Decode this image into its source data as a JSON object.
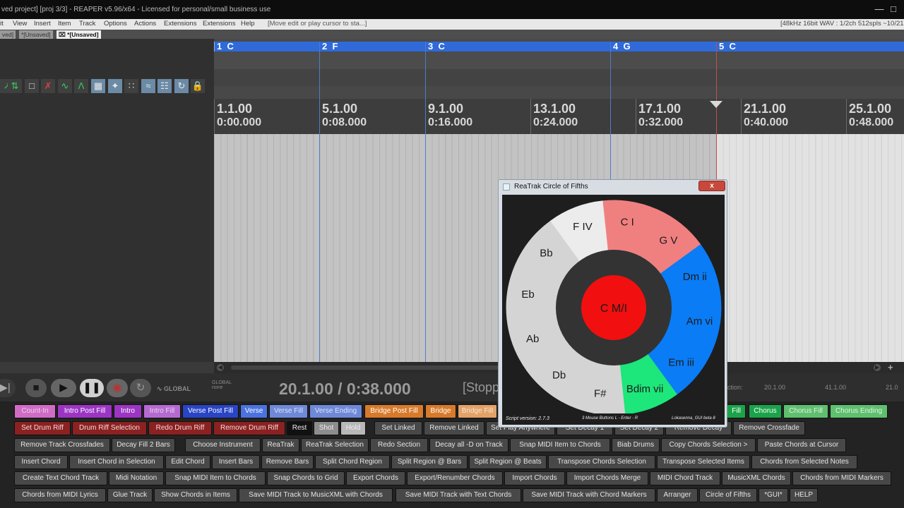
{
  "window": {
    "title": "ved project] [proj 3/3] - REAPER v5.96/x64 - Licensed for personal/small business use"
  },
  "menu": {
    "items": [
      "it",
      "View",
      "Insert",
      "Item",
      "Track",
      "Options",
      "Actions",
      "Extensions",
      "Extensions",
      "Help"
    ],
    "hint": "[Move edit or play cursor to sta...]",
    "status": "[48kHz 16bit WAV : 1/2ch 512spls ~10/21m"
  },
  "tabs": [
    "ved]",
    "*[Unsaved]",
    "*[Unsaved]"
  ],
  "regions": [
    {
      "num": "1",
      "chord": "C"
    },
    {
      "num": "2",
      "chord": "F"
    },
    {
      "num": "3",
      "chord": "C"
    },
    {
      "num": "4",
      "chord": "G"
    },
    {
      "num": "5",
      "chord": "C"
    }
  ],
  "ruler": [
    {
      "bar": "1.1.00",
      "time": "0:00.000"
    },
    {
      "bar": "5.1.00",
      "time": "0:08.000"
    },
    {
      "bar": "9.1.00",
      "time": "0:16.000"
    },
    {
      "bar": "13.1.00",
      "time": "0:24.000"
    },
    {
      "bar": "17.1.00",
      "time": "0:32.000"
    },
    {
      "bar": "21.1.00",
      "time": "0:40.000"
    },
    {
      "bar": "25.1.00",
      "time": "0:48.000"
    }
  ],
  "transport": {
    "global_label": "GLOBAL",
    "global_sub": "none",
    "position": "20.1.00 / 0:38.000",
    "state": "[Stopp",
    "selection_label": "ction:",
    "sel_values": [
      "20.1.00",
      "41.1.00",
      "21.0"
    ]
  },
  "dialog": {
    "title": "ReaTrak Circle of Fifths",
    "close": "x",
    "center": "C M/I",
    "segments": [
      {
        "label": "C I",
        "color": "#f08080"
      },
      {
        "label": "G V",
        "color": "#f08080"
      },
      {
        "label": "Dm ii",
        "color": "#0a7cf5"
      },
      {
        "label": "Am vi",
        "color": "#0a7cf5"
      },
      {
        "label": "Em iii",
        "color": "#0a7cf5"
      },
      {
        "label": "Bdim vii",
        "color": "#1de67a"
      },
      {
        "label": "F#",
        "color": "#d4d4d4"
      },
      {
        "label": "Db",
        "color": "#d4d4d4"
      },
      {
        "label": "Ab",
        "color": "#d4d4d4"
      },
      {
        "label": "Eb",
        "color": "#d4d4d4"
      },
      {
        "label": "Bb",
        "color": "#d4d4d4"
      },
      {
        "label": "F IV",
        "color": "#ececec"
      }
    ],
    "footer_left": "Script version: 2.7.3",
    "footer_mid": "3 Mouse Buttons L - Enter - R",
    "footer_right": "Lokasenna_GUI beta 8"
  },
  "buttons": {
    "row1": [
      "Count-In",
      "Intro Post Fill",
      "Intro",
      "Intro Fill",
      "Verse Post Fill",
      "Verse",
      "Verse Fill",
      "Verse Ending",
      "Bridge Post Fill",
      "Bridge",
      "Bridge Fill",
      "Fill",
      "Chorus",
      "Chorus Fill",
      "Chorus Ending"
    ],
    "row2": [
      "Set Drum Riff",
      "Drum Riff Selection",
      "Redo Drum Riff",
      "Remove Drum Riff",
      "Rest",
      "Shot",
      "Hold",
      "Set Linked",
      "Remove Linked",
      "Set Play Anywhere",
      "Set Decay 1",
      "Set Decay 2",
      "Remove Decay",
      "Remove Crossfade"
    ],
    "row3": [
      "Remove Track Crossfades",
      "Decay Fill 2 Bars",
      "Choose Instrument",
      "ReaTrak",
      "ReaTrak Selection",
      "Redo Section",
      "Decay all -D on Track",
      "Snap MIDI Item to Chords",
      "Biab Drums",
      "Copy Chords Selection >",
      "Paste Chords at Cursor"
    ],
    "row4": [
      "Insert Chord",
      "Insert Chord in Selection",
      "Edit Chord",
      "Insert Bars",
      "Remove Bars",
      "Split Chord Region",
      "Split Region @ Bars",
      "Split Region @ Beats",
      "Transpose Chords Selection",
      "Transpose Selected Items",
      "Chords from Selected Notes"
    ],
    "row5": [
      "Create Text Chord Track",
      "Midi Notation",
      "Snap MIDI Item to Chords",
      "Snap Chords to Grid",
      "Export Chords",
      "Export/Renumber Chords",
      "Import Chords",
      "Import Chords Merge",
      "MIDI Chord Track",
      "MusicXML Chords",
      "Chords from MIDI Markers"
    ],
    "row6": [
      "Chords from MIDI Lyrics",
      "Glue Track",
      "Show Chords in Items",
      "Save MIDI Track to MusicXML with Chords",
      "Save MIDI Track with Text Chords",
      "Save MIDI Track with Chord Markers",
      "Arranger",
      "Circle of Fifths",
      "*GUI*",
      "HELP"
    ]
  }
}
